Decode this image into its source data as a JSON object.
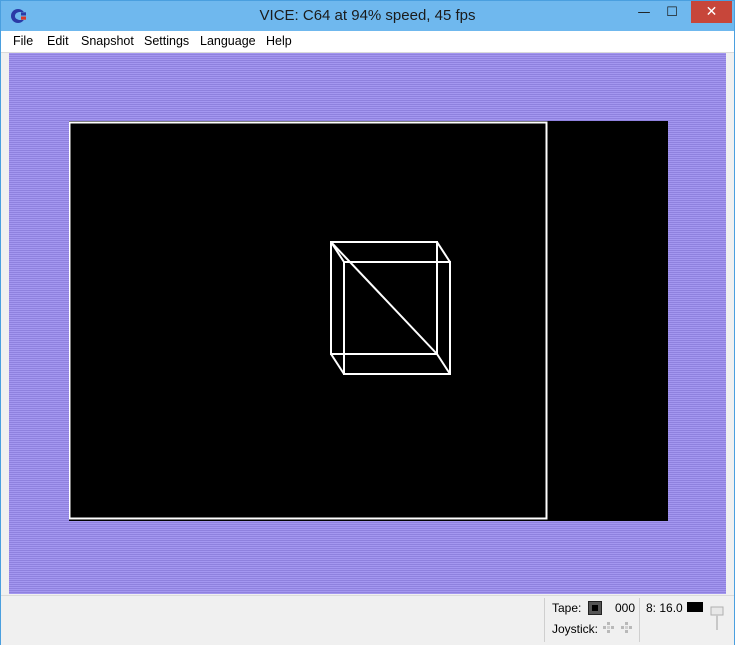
{
  "window": {
    "title": "VICE: C64 at 94% speed, 45 fps",
    "minimize_glyph": "—",
    "maximize_glyph": "☐",
    "close_glyph": "✕"
  },
  "menu": {
    "items": [
      "File",
      "Edit",
      "Snapshot",
      "Settings",
      "Language",
      "Help"
    ]
  },
  "status": {
    "tape_label": "Tape:",
    "tape_counter": "000",
    "drive_label": "8: 16.0",
    "joystick_label": "Joystick:"
  },
  "colors": {
    "titlebar": "#6fb8ee",
    "close_button": "#c7463a",
    "c64_border": "#9b8ee8",
    "c64_screen": "#000000",
    "wireframe": "#ffffff"
  },
  "icons": {
    "app": "commodore-logo-icon",
    "tape": "tape-status-icon",
    "joystick": "joystick-port-icon",
    "grip": "resize-grip-icon"
  }
}
